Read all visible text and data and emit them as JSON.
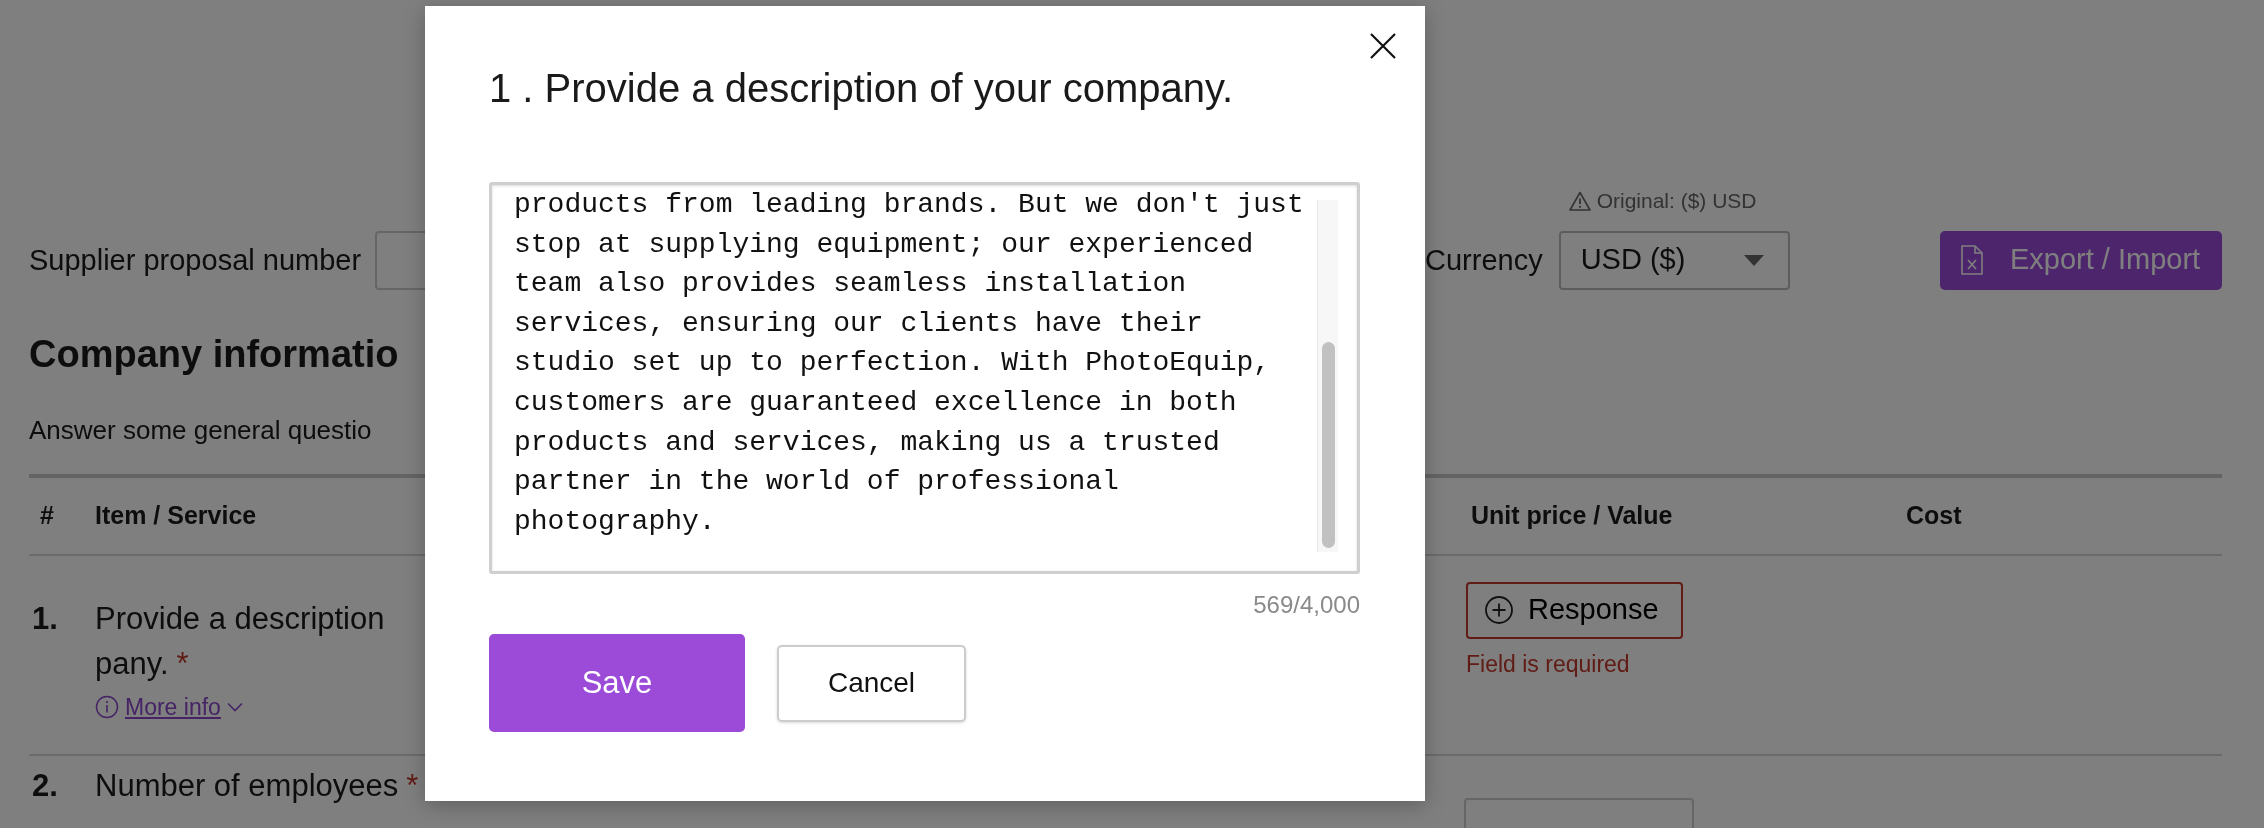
{
  "page": {
    "proposal_label": "Supplier proposal number",
    "currency": {
      "note": "Original: ($) USD",
      "label": "Currency",
      "value": "USD ($)"
    },
    "export_button": "Export / Import",
    "section_title": "Company informatio",
    "section_subtitle": "Answer some general questio",
    "table": {
      "columns": [
        "#",
        "Item / Service",
        "Unit price / Value",
        "Cost"
      ],
      "rows": [
        {
          "number": "1.",
          "item_lines": [
            "Provide a description",
            "pany."
          ],
          "required_mark": "*",
          "more_info": "More info",
          "response_button": "Response",
          "error": "Field is required"
        },
        {
          "number": "2.",
          "item_lines": [
            "Number of employees"
          ],
          "required_mark": "*",
          "has_field": true
        }
      ]
    }
  },
  "dialog": {
    "title": "1 . Provide a description of your company.",
    "answer": "products from leading brands. But we don't just stop at supplying equipment; our experienced team also provides seamless installation services, ensuring our clients have their studio set up to perfection. With PhotoEquip, customers are guaranteed excellence in both products and services, making us a trusted partner in the world of professional photography.",
    "counter": "569/4,000",
    "buttons": [
      {
        "label": "Save",
        "kind": "primary"
      },
      {
        "label": "Cancel",
        "kind": "secondary"
      }
    ]
  }
}
